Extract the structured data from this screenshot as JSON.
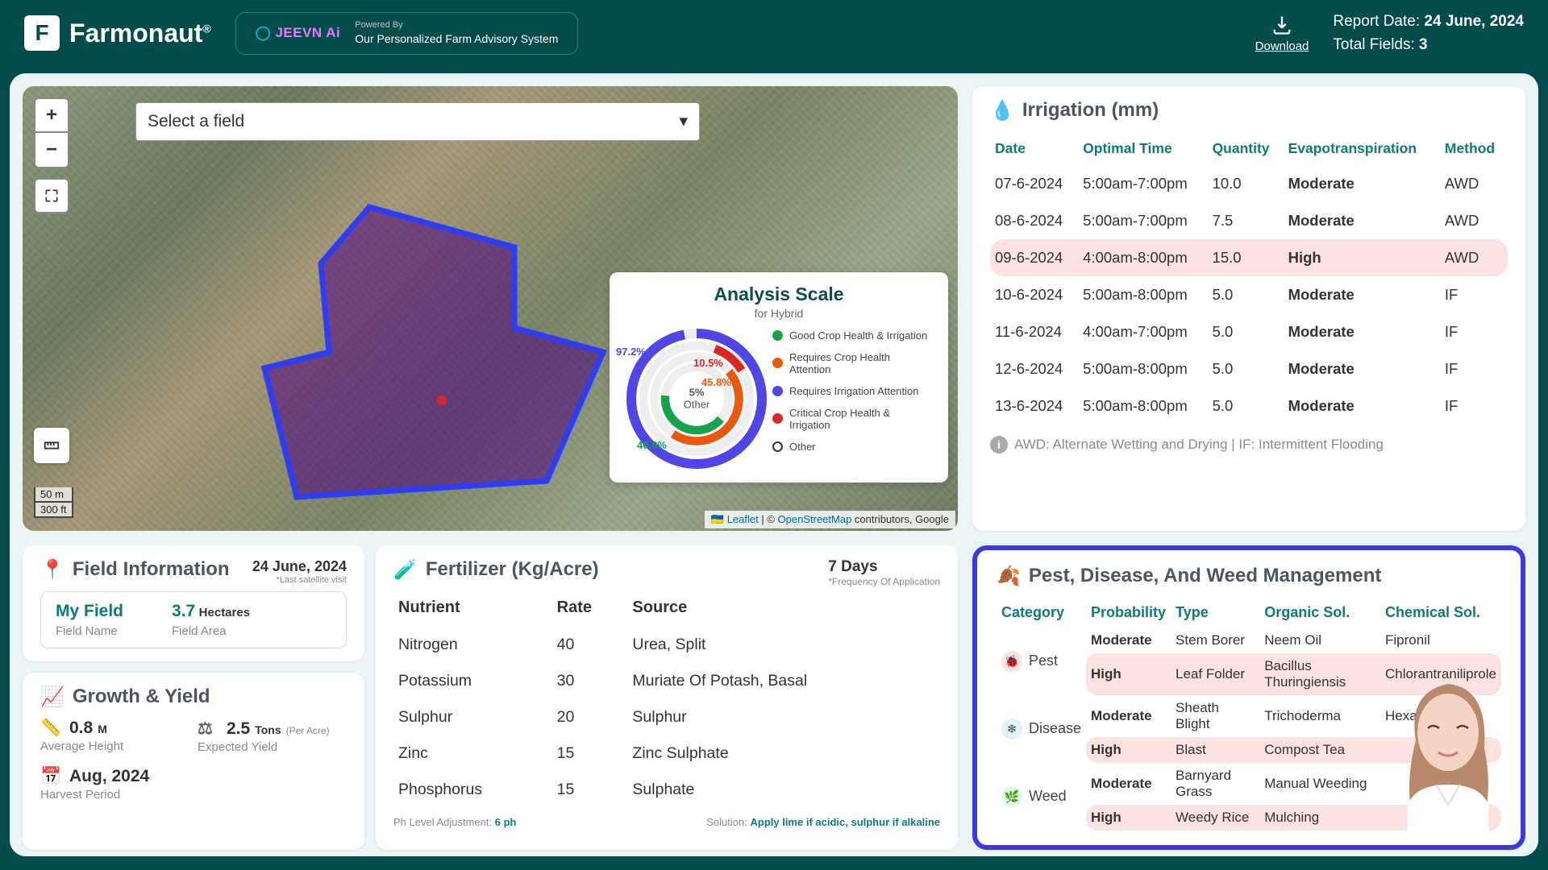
{
  "header": {
    "brand": "Farmonaut",
    "trademark": "®",
    "jeevn_brand": "JEEVN Ai",
    "powered_by_label": "Powered By",
    "powered_by_text": "Our Personalized Farm Advisory System",
    "download_label": "Download",
    "report_date_label": "Report Date:",
    "report_date_value": "24 June, 2024",
    "total_fields_label": "Total Fields:",
    "total_fields_value": "3"
  },
  "map": {
    "field_select_placeholder": "Select a field",
    "scale_metric": "50 m",
    "scale_imperial": "300 ft",
    "attrib_leaflet": "Leaflet",
    "attrib_osm": "OpenStreetMap",
    "attrib_tail": " contributors, Google",
    "analysis": {
      "title": "Analysis Scale",
      "subtitle": "for Hybrid",
      "center_pct": "5%",
      "center_label": "Other",
      "labels": {
        "purple": "97.2%",
        "red": "10.5%",
        "orange": "45.8%",
        "green": "40.8%"
      },
      "legend": [
        {
          "label": "Good Crop Health & Irrigation",
          "color": "#16a34a"
        },
        {
          "label": "Requires Crop Health Attention",
          "color": "#ea580c"
        },
        {
          "label": "Requires Irrigation Attention",
          "color": "#4f46e5"
        },
        {
          "label": "Critical Crop Health & Irrigation",
          "color": "#dc2626"
        },
        {
          "label": "Other",
          "color": "#ffffff"
        }
      ]
    }
  },
  "irrigation": {
    "title": "Irrigation (mm)",
    "columns": [
      "Date",
      "Optimal Time",
      "Quantity",
      "Evapotranspiration",
      "Method"
    ],
    "rows": [
      {
        "date": "07-6-2024",
        "time": "5:00am-7:00pm",
        "qty": "10.0",
        "ev": "Moderate",
        "method": "AWD",
        "hi": false
      },
      {
        "date": "08-6-2024",
        "time": "5:00am-7:00pm",
        "qty": "7.5",
        "ev": "Moderate",
        "method": "AWD",
        "hi": false
      },
      {
        "date": "09-6-2024",
        "time": "4:00am-8:00pm",
        "qty": "15.0",
        "ev": "High",
        "method": "AWD",
        "hi": true
      },
      {
        "date": "10-6-2024",
        "time": "5:00am-8:00pm",
        "qty": "5.0",
        "ev": "Moderate",
        "method": "IF",
        "hi": false
      },
      {
        "date": "11-6-2024",
        "time": "4:00am-7:00pm",
        "qty": "5.0",
        "ev": "Moderate",
        "method": "IF",
        "hi": false
      },
      {
        "date": "12-6-2024",
        "time": "5:00am-8:00pm",
        "qty": "5.0",
        "ev": "Moderate",
        "method": "IF",
        "hi": false
      },
      {
        "date": "13-6-2024",
        "time": "5:00am-8:00pm",
        "qty": "5.0",
        "ev": "Moderate",
        "method": "IF",
        "hi": false
      }
    ],
    "footnote": "AWD: Alternate Wetting and Drying | IF: Intermittent Flooding"
  },
  "field_info": {
    "title": "Field Information",
    "date": "24 June, 2024",
    "note": "*Last satellite visit",
    "name_value": "My Field",
    "name_label": "Field Name",
    "area_value": "3.7",
    "area_unit": "Hectares",
    "area_label": "Field Area"
  },
  "growth": {
    "title": "Growth & Yield",
    "avg_height_value": "0.8",
    "avg_height_unit": "M",
    "avg_height_label": "Average Height",
    "yield_value": "2.5",
    "yield_unit": "Tons",
    "yield_per": "(Per Acre)",
    "yield_label": "Expected Yield",
    "harvest_value": "Aug, 2024",
    "harvest_label": "Harvest Period"
  },
  "fertilizer": {
    "title": "Fertilizer (Kg/Acre)",
    "days": "7 Days",
    "note": "*Frequency Of Application",
    "columns": [
      "Nutrient",
      "Rate",
      "Source"
    ],
    "rows": [
      {
        "n": "Nitrogen",
        "r": "40",
        "s": "Urea, Split"
      },
      {
        "n": "Potassium",
        "r": "30",
        "s": "Muriate Of Potash, Basal"
      },
      {
        "n": "Sulphur",
        "r": "20",
        "s": "Sulphur"
      },
      {
        "n": "Zinc",
        "r": "15",
        "s": "Zinc Sulphate"
      },
      {
        "n": "Phosphorus",
        "r": "15",
        "s": "Sulphate"
      }
    ],
    "ph_label": "Ph Level Adjustment:",
    "ph_value": "6 ph",
    "sol_label": "Solution:",
    "sol_value": "Apply lime if acidic, sulphur if alkaline"
  },
  "pest": {
    "title": "Pest, Disease, And Weed Management",
    "columns": [
      "Category",
      "Probability",
      "Type",
      "Organic Sol.",
      "Chemical Sol."
    ],
    "groups": [
      {
        "category": "Pest",
        "icon": "🐞",
        "bg": "#fde2e2",
        "rows": [
          {
            "prob": "Moderate",
            "type": "Stem Borer",
            "org": "Neem Oil",
            "chem": "Fipronil",
            "hi": false
          },
          {
            "prob": "High",
            "type": "Leaf Folder",
            "org": "Bacillus Thuringiensis",
            "chem": "Chlorantraniliprole",
            "hi": true
          }
        ]
      },
      {
        "category": "Disease",
        "icon": "❄",
        "bg": "#e0f2fe",
        "rows": [
          {
            "prob": "Moderate",
            "type": "Sheath Blight",
            "org": "Trichoderma",
            "chem": "Hexaconazole",
            "hi": false
          },
          {
            "prob": "High",
            "type": "Blast",
            "org": "Compost Tea",
            "chem": "",
            "hi": true
          }
        ]
      },
      {
        "category": "Weed",
        "icon": "🌿",
        "bg": "#dcfce7",
        "rows": [
          {
            "prob": "Moderate",
            "type": "Barnyard Grass",
            "org": "Manual Weeding",
            "chem": "",
            "hi": false
          },
          {
            "prob": "High",
            "type": "Weedy Rice",
            "org": "Mulching",
            "chem": "",
            "hi": true
          }
        ]
      }
    ]
  },
  "colors": {
    "teal": "#044b4b",
    "accent": "#0e7a7a",
    "mod": "#f59e0b",
    "high": "#dc2626",
    "border": "#3b39e6"
  }
}
